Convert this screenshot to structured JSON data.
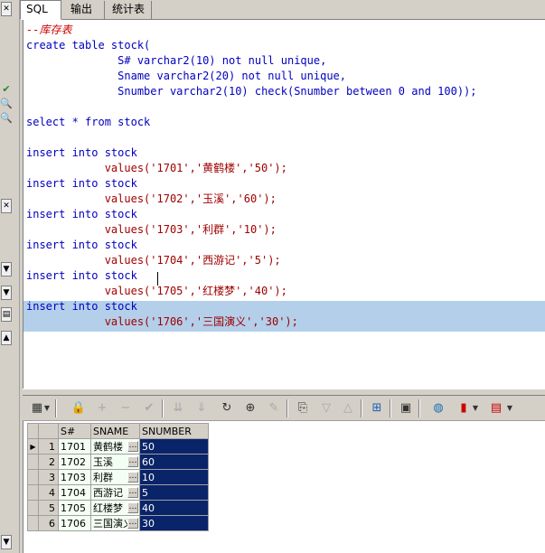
{
  "tabs": [
    {
      "label": "SQL"
    },
    {
      "label": "输出"
    },
    {
      "label": "统计表"
    }
  ],
  "editor": {
    "lines": [
      {
        "cls": "cm",
        "text": "--库存表"
      },
      {
        "cls": "kw",
        "text": "create table stock("
      },
      {
        "cls": "kw",
        "text": "              S# varchar2(10) not null unique,"
      },
      {
        "cls": "kw",
        "text": "              Sname varchar2(20) not null unique,"
      },
      {
        "cls": "kw",
        "text": "              Snumber varchar2(10) check(Snumber between 0 and 100));"
      },
      {
        "cls": "kw",
        "text": ""
      },
      {
        "cls": "kw",
        "text": "select * from stock"
      },
      {
        "cls": "kw",
        "text": ""
      },
      {
        "cls": "kw",
        "text": "insert into stock"
      },
      {
        "cls": "str",
        "text": "            values('1701','黄鹤楼','50');"
      },
      {
        "cls": "kw",
        "text": "insert into stock"
      },
      {
        "cls": "str",
        "text": "            values('1702','玉溪','60');"
      },
      {
        "cls": "kw",
        "text": "insert into stock"
      },
      {
        "cls": "str",
        "text": "            values('1703','利群','10');"
      },
      {
        "cls": "kw",
        "text": "insert into stock"
      },
      {
        "cls": "str",
        "text": "            values('1704','西游记','5');"
      },
      {
        "cls": "kw",
        "text": "insert into stock"
      },
      {
        "cls": "str",
        "text": "            values('1705','红楼梦','40');"
      },
      {
        "cls": "kw",
        "text": "insert into stock"
      },
      {
        "cls": "str",
        "text": "            values('1706','三国演义','30');"
      }
    ]
  },
  "toolbar": {
    "icons": [
      "grid-view-icon",
      "dropdown-arrow-icon",
      "lock-icon",
      "add-record-icon",
      "delete-record-icon",
      "post-edit-icon",
      "first-page-icon",
      "next-page-icon",
      "refresh-icon",
      "find-icon",
      "clear-icon",
      "export-icon",
      "filter-down-icon",
      "filter-up-icon",
      "tree-icon",
      "save-icon",
      "database-icon",
      "chart-icon",
      "table-icon"
    ]
  },
  "grid": {
    "columns": [
      "S#",
      "SNAME",
      "SNUMBER"
    ],
    "rows": [
      {
        "n": "1",
        "sid": "1701",
        "name": "黄鹤楼",
        "num": "50"
      },
      {
        "n": "2",
        "sid": "1702",
        "name": "玉溪",
        "num": "60"
      },
      {
        "n": "3",
        "sid": "1703",
        "name": "利群",
        "num": "10"
      },
      {
        "n": "4",
        "sid": "1704",
        "name": "西游记",
        "num": "5"
      },
      {
        "n": "5",
        "sid": "1705",
        "name": "红楼梦",
        "num": "40"
      },
      {
        "n": "6",
        "sid": "1706",
        "name": "三国演义",
        "num": "30"
      }
    ],
    "ellipsis": "…"
  },
  "colors": {
    "keyword": "#0000c0",
    "selection": "#b3cfea",
    "grid_selected": "#0a246a"
  }
}
